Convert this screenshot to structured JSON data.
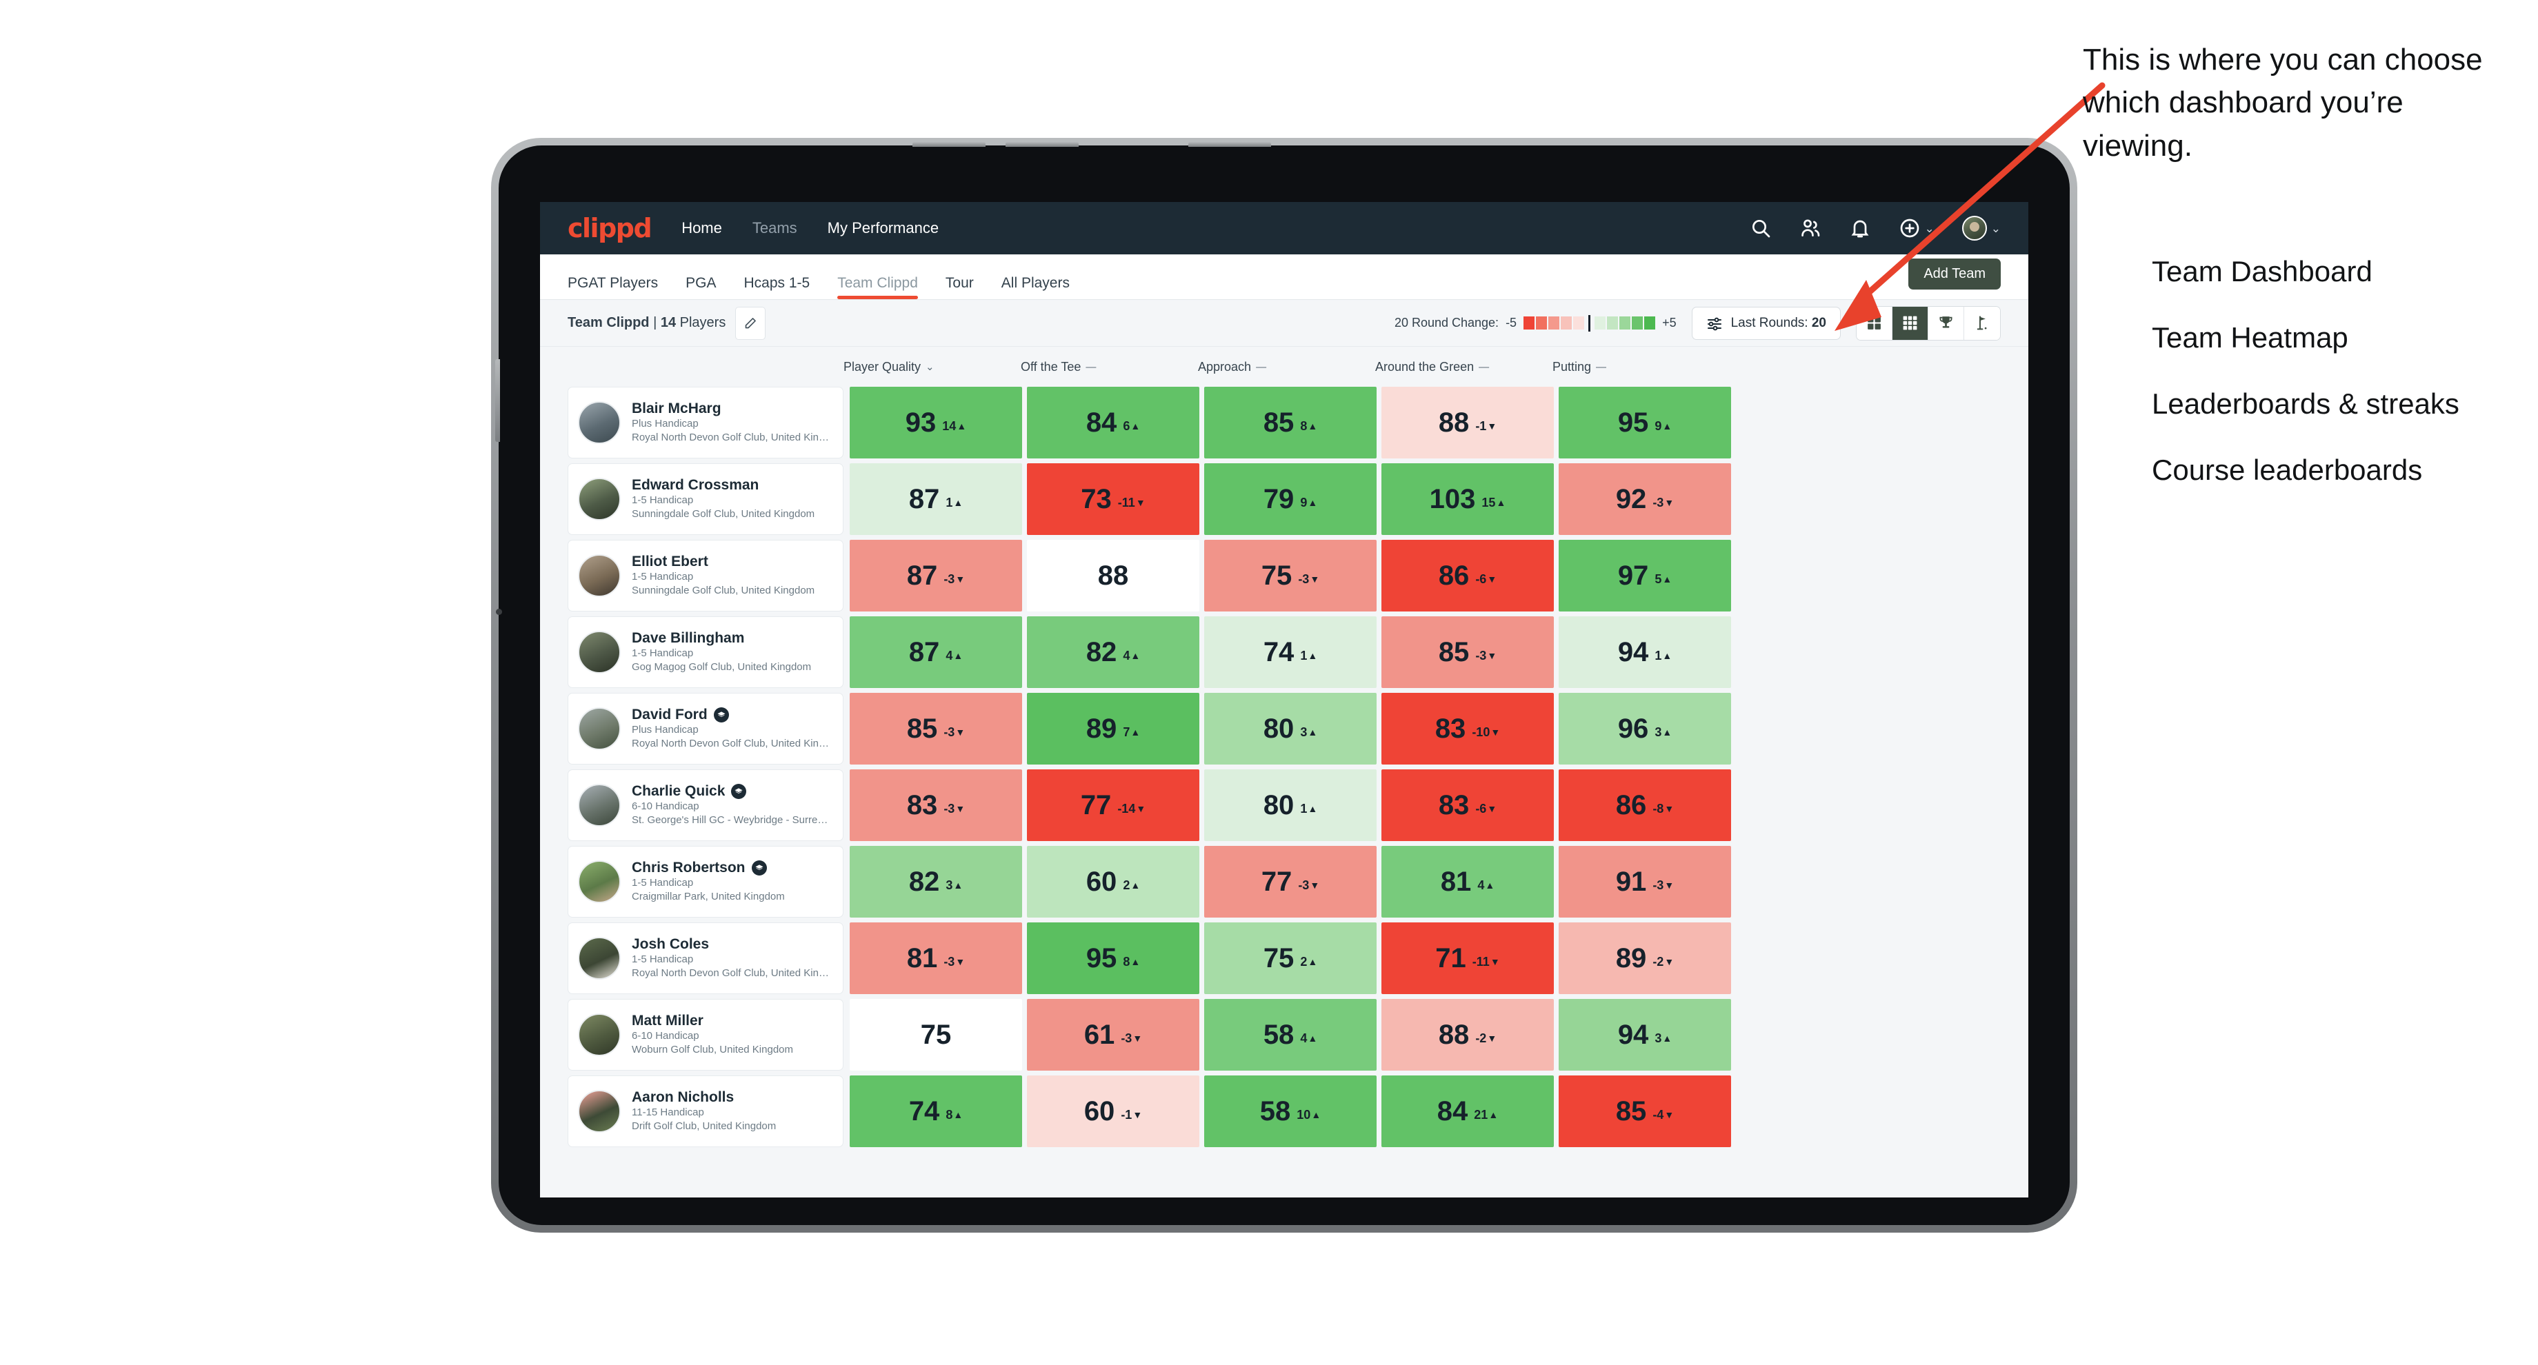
{
  "header": {
    "brand": "clippd",
    "nav": [
      {
        "label": "Home",
        "dim": false
      },
      {
        "label": "Teams",
        "dim": true
      },
      {
        "label": "My Performance",
        "dim": false
      }
    ],
    "actions": [
      {
        "name": "search-icon"
      },
      {
        "name": "people-icon"
      },
      {
        "name": "notifications-icon"
      },
      {
        "name": "add-icon"
      },
      {
        "name": "avatar"
      }
    ]
  },
  "tabs": {
    "items": [
      {
        "label": "PGAT Players",
        "active": false,
        "dim": false
      },
      {
        "label": "PGA",
        "active": false,
        "dim": false
      },
      {
        "label": "Hcaps 1-5",
        "active": false,
        "dim": false
      },
      {
        "label": "Team Clippd",
        "active": true,
        "dim": true
      },
      {
        "label": "Tour",
        "active": false,
        "dim": false
      },
      {
        "label": "All Players",
        "active": false,
        "dim": false
      }
    ],
    "add_team_label": "Add Team"
  },
  "toolbar": {
    "team_name": "Team Clippd",
    "team_separator": " | ",
    "player_count": "14",
    "players_word": " Players",
    "legend_label": "20 Round Change:",
    "legend_min": "-5",
    "legend_max": "+5",
    "legend_colors_negative": [
      "#ef4436",
      "#f1705f",
      "#f4998c",
      "#f8c2ba",
      "#fbe0dc"
    ],
    "legend_colors_positive": [
      "#e0f1e0",
      "#c3e6c2",
      "#9bd79a",
      "#6bc46c",
      "#4cb950"
    ],
    "last_rounds_label": "Last Rounds:",
    "last_rounds_value": "20",
    "views": [
      {
        "name": "dashboard-grid-icon",
        "active": false
      },
      {
        "name": "heatmap-grid-icon",
        "active": true
      },
      {
        "name": "trophy-icon",
        "active": false
      },
      {
        "name": "golf-flag-icon",
        "active": false
      }
    ]
  },
  "columns": [
    {
      "label": "Player Quality",
      "glyph": "⌄"
    },
    {
      "label": "Off the Tee",
      "glyph": "—"
    },
    {
      "label": "Approach",
      "glyph": "—"
    },
    {
      "label": "Around the Green",
      "glyph": "—"
    },
    {
      "label": "Putting",
      "glyph": "—"
    }
  ],
  "chart_data": {
    "type": "heatmap",
    "title": "Team Clippd — Team Heatmap",
    "xlabel": "",
    "ylabel": "",
    "categories": [
      "Player Quality",
      "Off the Tee",
      "Approach",
      "Around the Green",
      "Putting"
    ],
    "value_scale": "0-110 quality score",
    "delta_scale": "20 Round Change, -5 to +5",
    "rows": [
      {
        "player": "Blair McHarg",
        "values": [
          93,
          84,
          85,
          88,
          95
        ],
        "deltas": [
          14,
          6,
          8,
          -1,
          9
        ]
      },
      {
        "player": "Edward Crossman",
        "values": [
          87,
          73,
          79,
          103,
          92
        ],
        "deltas": [
          1,
          -11,
          9,
          15,
          -3
        ]
      },
      {
        "player": "Elliot Ebert",
        "values": [
          87,
          88,
          75,
          86,
          97
        ],
        "deltas": [
          -3,
          null,
          -3,
          -6,
          5
        ]
      },
      {
        "player": "Dave Billingham",
        "values": [
          87,
          82,
          74,
          85,
          94
        ],
        "deltas": [
          4,
          4,
          1,
          -3,
          1
        ]
      },
      {
        "player": "David Ford",
        "values": [
          85,
          89,
          80,
          83,
          96
        ],
        "deltas": [
          -3,
          7,
          3,
          -10,
          3
        ]
      },
      {
        "player": "Charlie Quick",
        "values": [
          83,
          77,
          80,
          83,
          86
        ],
        "deltas": [
          -3,
          -14,
          1,
          -6,
          -8
        ]
      },
      {
        "player": "Chris Robertson",
        "values": [
          82,
          60,
          77,
          81,
          91
        ],
        "deltas": [
          3,
          2,
          -3,
          4,
          -3
        ]
      },
      {
        "player": "Josh Coles",
        "values": [
          81,
          95,
          75,
          71,
          89
        ],
        "deltas": [
          -3,
          8,
          2,
          -11,
          -2
        ]
      },
      {
        "player": "Matt Miller",
        "values": [
          75,
          61,
          58,
          88,
          94
        ],
        "deltas": [
          null,
          -3,
          4,
          -2,
          3
        ]
      },
      {
        "player": "Aaron Nicholls",
        "values": [
          74,
          60,
          58,
          84,
          85
        ],
        "deltas": [
          8,
          -1,
          10,
          21,
          -4
        ]
      }
    ]
  },
  "players": [
    {
      "name": "Blair McHarg",
      "handicap": "Plus Handicap",
      "club": "Royal North Devon Golf Club, United Kingdom",
      "verified": false,
      "avatar_colors": [
        "#9aa6ad",
        "#5c6a72",
        "#3d4a50"
      ],
      "cells": [
        {
          "value": "93",
          "delta": "14",
          "dir": "up",
          "bg": "#62c267"
        },
        {
          "value": "84",
          "delta": "6",
          "dir": "up",
          "bg": "#62c267"
        },
        {
          "value": "85",
          "delta": "8",
          "dir": "up",
          "bg": "#62c267"
        },
        {
          "value": "88",
          "delta": "-1",
          "dir": "down",
          "bg": "#fadcd7"
        },
        {
          "value": "95",
          "delta": "9",
          "dir": "up",
          "bg": "#62c267"
        }
      ]
    },
    {
      "name": "Edward Crossman",
      "handicap": "1-5 Handicap",
      "club": "Sunningdale Golf Club, United Kingdom",
      "verified": false,
      "avatar_colors": [
        "#8fa07c",
        "#4e5b47",
        "#2d3629"
      ],
      "cells": [
        {
          "value": "87",
          "delta": "1",
          "dir": "up",
          "bg": "#dcefdd"
        },
        {
          "value": "73",
          "delta": "-11",
          "dir": "down",
          "bg": "#ef4436"
        },
        {
          "value": "79",
          "delta": "9",
          "dir": "up",
          "bg": "#62c267"
        },
        {
          "value": "103",
          "delta": "15",
          "dir": "up",
          "bg": "#62c267"
        },
        {
          "value": "92",
          "delta": "-3",
          "dir": "down",
          "bg": "#f1948a"
        }
      ]
    },
    {
      "name": "Elliot Ebert",
      "handicap": "1-5 Handicap",
      "club": "Sunningdale Golf Club, United Kingdom",
      "verified": false,
      "avatar_colors": [
        "#b0a08c",
        "#7a6a55",
        "#3e372f"
      ],
      "cells": [
        {
          "value": "87",
          "delta": "-3",
          "dir": "down",
          "bg": "#f1948a"
        },
        {
          "value": "88",
          "delta": "",
          "dir": "none",
          "bg": "#ffffff"
        },
        {
          "value": "75",
          "delta": "-3",
          "dir": "down",
          "bg": "#f1948a"
        },
        {
          "value": "86",
          "delta": "-6",
          "dir": "down",
          "bg": "#ef4436"
        },
        {
          "value": "97",
          "delta": "5",
          "dir": "up",
          "bg": "#62c267"
        }
      ]
    },
    {
      "name": "Dave Billingham",
      "handicap": "1-5 Handicap",
      "club": "Gog Magog Golf Club, United Kingdom",
      "verified": false,
      "avatar_colors": [
        "#7f8a6f",
        "#4d5746",
        "#2b3226"
      ],
      "cells": [
        {
          "value": "87",
          "delta": "4",
          "dir": "up",
          "bg": "#78cb7c"
        },
        {
          "value": "82",
          "delta": "4",
          "dir": "up",
          "bg": "#78cb7c"
        },
        {
          "value": "74",
          "delta": "1",
          "dir": "up",
          "bg": "#dcefdd"
        },
        {
          "value": "85",
          "delta": "-3",
          "dir": "down",
          "bg": "#f1948a"
        },
        {
          "value": "94",
          "delta": "1",
          "dir": "up",
          "bg": "#dcefdd"
        }
      ]
    },
    {
      "name": "David Ford",
      "handicap": "Plus Handicap",
      "club": "Royal North Devon Golf Club, United Kingdom",
      "verified": true,
      "avatar_colors": [
        "#9fa9a5",
        "#6f7a6a",
        "#43503f"
      ],
      "cells": [
        {
          "value": "85",
          "delta": "-3",
          "dir": "down",
          "bg": "#f1948a"
        },
        {
          "value": "89",
          "delta": "7",
          "dir": "up",
          "bg": "#5bbf60"
        },
        {
          "value": "80",
          "delta": "3",
          "dir": "up",
          "bg": "#a6dca6"
        },
        {
          "value": "83",
          "delta": "-10",
          "dir": "down",
          "bg": "#ef4436"
        },
        {
          "value": "96",
          "delta": "3",
          "dir": "up",
          "bg": "#a6dca6"
        }
      ]
    },
    {
      "name": "Charlie Quick",
      "handicap": "6-10 Handicap",
      "club": "St. George's Hill GC - Weybridge - Surrey, Uni...",
      "verified": true,
      "avatar_colors": [
        "#a8b0b5",
        "#68736b",
        "#3b463a"
      ],
      "cells": [
        {
          "value": "83",
          "delta": "-3",
          "dir": "down",
          "bg": "#f1948a"
        },
        {
          "value": "77",
          "delta": "-14",
          "dir": "down",
          "bg": "#ef4436"
        },
        {
          "value": "80",
          "delta": "1",
          "dir": "up",
          "bg": "#dcefdd"
        },
        {
          "value": "83",
          "delta": "-6",
          "dir": "down",
          "bg": "#ef4436"
        },
        {
          "value": "86",
          "delta": "-8",
          "dir": "down",
          "bg": "#ef4436"
        }
      ]
    },
    {
      "name": "Chris Robertson",
      "handicap": "1-5 Handicap",
      "club": "Craigmillar Park, United Kingdom",
      "verified": true,
      "avatar_colors": [
        "#8cb06d",
        "#5c7a48",
        "#c9a98c"
      ],
      "cells": [
        {
          "value": "82",
          "delta": "3",
          "dir": "up",
          "bg": "#96d596"
        },
        {
          "value": "60",
          "delta": "2",
          "dir": "up",
          "bg": "#bde5bd"
        },
        {
          "value": "77",
          "delta": "-3",
          "dir": "down",
          "bg": "#f1948a"
        },
        {
          "value": "81",
          "delta": "4",
          "dir": "up",
          "bg": "#78cb7c"
        },
        {
          "value": "91",
          "delta": "-3",
          "dir": "down",
          "bg": "#f1948a"
        }
      ]
    },
    {
      "name": "Josh Coles",
      "handicap": "1-5 Handicap",
      "club": "Royal North Devon Golf Club, United Kingdom",
      "verified": false,
      "avatar_colors": [
        "#5c6b4c",
        "#3c4634",
        "#e8e4da"
      ],
      "cells": [
        {
          "value": "81",
          "delta": "-3",
          "dir": "down",
          "bg": "#f1948a"
        },
        {
          "value": "95",
          "delta": "8",
          "dir": "up",
          "bg": "#5bbf60"
        },
        {
          "value": "75",
          "delta": "2",
          "dir": "up",
          "bg": "#a6dca6"
        },
        {
          "value": "71",
          "delta": "-11",
          "dir": "down",
          "bg": "#ef4436"
        },
        {
          "value": "89",
          "delta": "-2",
          "dir": "down",
          "bg": "#f6b8b0"
        }
      ]
    },
    {
      "name": "Matt Miller",
      "handicap": "6-10 Handicap",
      "club": "Woburn Golf Club, United Kingdom",
      "verified": false,
      "avatar_colors": [
        "#7e8a63",
        "#4f5a3f",
        "#2f3727"
      ],
      "cells": [
        {
          "value": "75",
          "delta": "",
          "dir": "none",
          "bg": "#ffffff"
        },
        {
          "value": "61",
          "delta": "-3",
          "dir": "down",
          "bg": "#f1948a"
        },
        {
          "value": "58",
          "delta": "4",
          "dir": "up",
          "bg": "#78cb7c"
        },
        {
          "value": "88",
          "delta": "-2",
          "dir": "down",
          "bg": "#f6b8b0"
        },
        {
          "value": "94",
          "delta": "3",
          "dir": "up",
          "bg": "#96d596"
        }
      ]
    },
    {
      "name": "Aaron Nicholls",
      "handicap": "11-15 Handicap",
      "club": "Drift Golf Club, United Kingdom",
      "verified": false,
      "avatar_colors": [
        "#f1a39a",
        "#3d4a36",
        "#6b7d52"
      ],
      "cells": [
        {
          "value": "74",
          "delta": "8",
          "dir": "up",
          "bg": "#62c267"
        },
        {
          "value": "60",
          "delta": "-1",
          "dir": "down",
          "bg": "#fadcd7"
        },
        {
          "value": "58",
          "delta": "10",
          "dir": "up",
          "bg": "#62c267"
        },
        {
          "value": "84",
          "delta": "21",
          "dir": "up",
          "bg": "#62c267"
        },
        {
          "value": "85",
          "delta": "-4",
          "dir": "down",
          "bg": "#ef4436"
        }
      ]
    }
  ],
  "annotation": {
    "callout": "This is where you can choose which dashboard you’re viewing.",
    "options": [
      "Team Dashboard",
      "Team Heatmap",
      "Leaderboards & streaks",
      "Course leaderboards"
    ],
    "arrow_color": "#e8422c"
  }
}
